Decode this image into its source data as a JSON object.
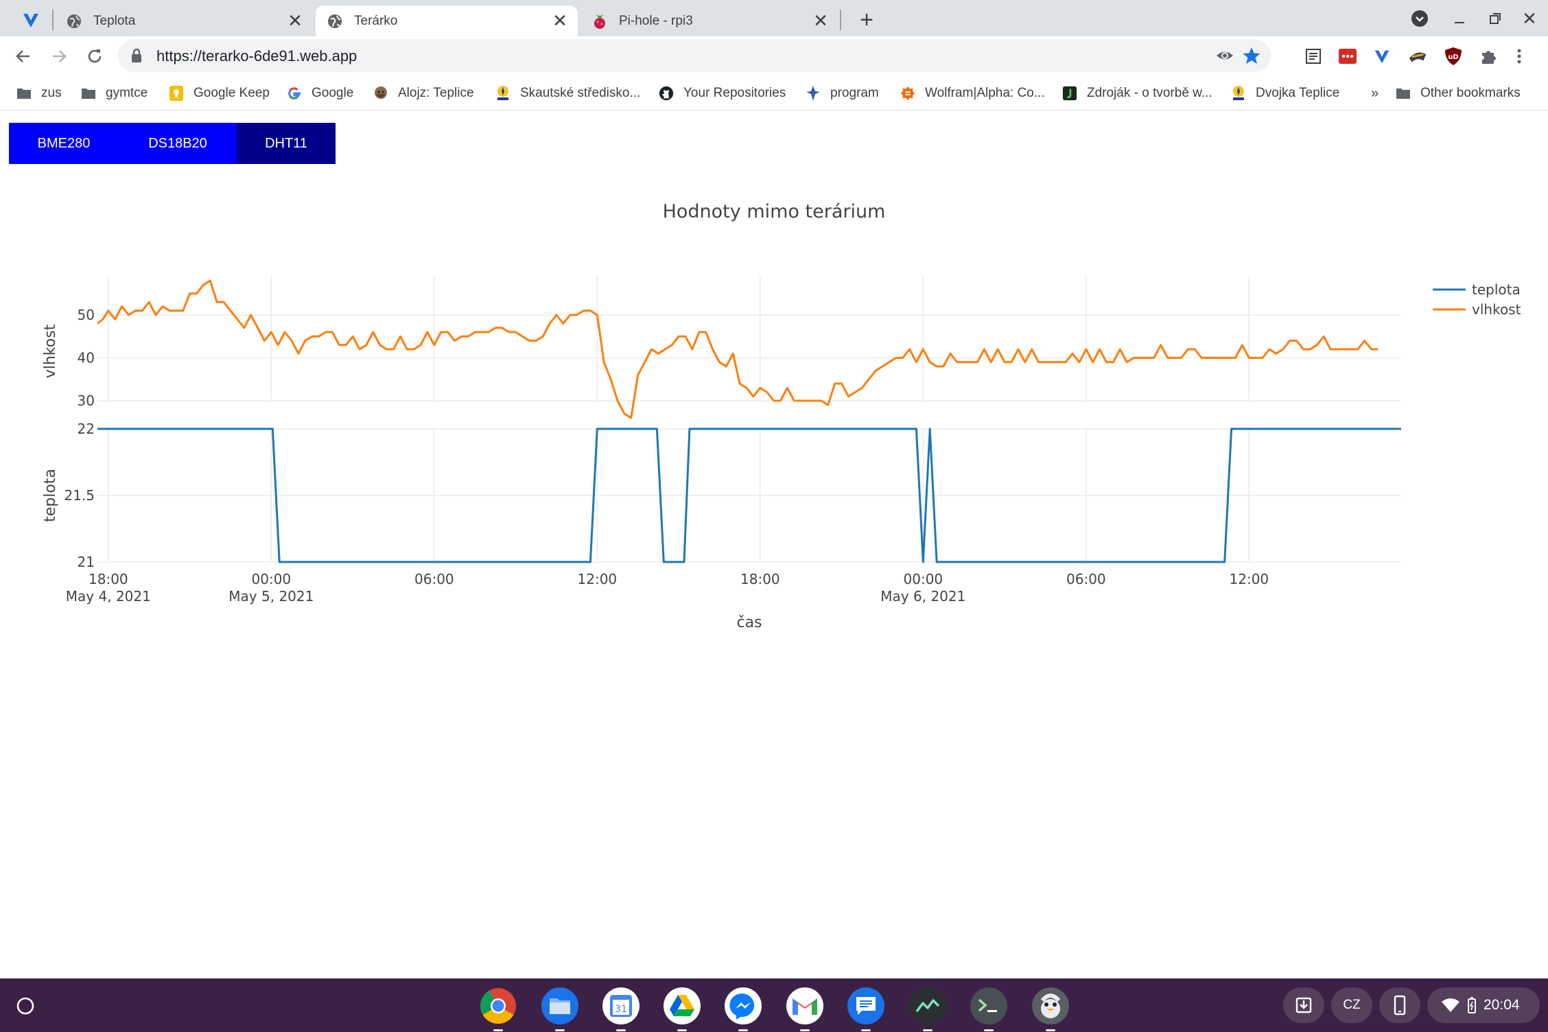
{
  "browser": {
    "tabs": [
      {
        "title": "Teplota",
        "active": false
      },
      {
        "title": "Terárko",
        "active": true
      },
      {
        "title": "Pi-hole - rpi3",
        "active": false
      }
    ],
    "url": "https://terarko-6de91.web.app",
    "bookmarks": [
      {
        "label": "zus",
        "icon": "folder-icon"
      },
      {
        "label": "gymtce",
        "icon": "folder-icon"
      },
      {
        "label": "Google Keep",
        "icon": "keep-icon"
      },
      {
        "label": "Google",
        "icon": "google-icon"
      },
      {
        "label": "Alojz: Teplice",
        "icon": "alojz-icon"
      },
      {
        "label": "Skautské středisko...",
        "icon": "scout-icon"
      },
      {
        "label": "Your Repositories",
        "icon": "github-icon"
      },
      {
        "label": "program",
        "icon": "fleur-icon"
      },
      {
        "label": "Wolfram|Alpha: Co...",
        "icon": "wolfram-icon"
      },
      {
        "label": "Zdroják - o tvorbě w...",
        "icon": "zdrojak-icon"
      },
      {
        "label": "Dvojka Teplice",
        "icon": "scout-icon"
      }
    ],
    "overflow_label": "»",
    "other_bookmarks": "Other bookmarks"
  },
  "sensor_tabs": [
    {
      "label": "BME280",
      "selected": false
    },
    {
      "label": "DS18B20",
      "selected": false
    },
    {
      "label": "DHT11",
      "selected": true
    }
  ],
  "chart_data": {
    "type": "line",
    "title": "Hodnoty mimo terárium",
    "xlabel": "čas",
    "x_ticks": [
      {
        "hour": 18,
        "label": "18:00",
        "sub": "May 4, 2021"
      },
      {
        "hour": 24,
        "label": "00:00",
        "sub": "May 5, 2021"
      },
      {
        "hour": 30,
        "label": "06:00",
        "sub": ""
      },
      {
        "hour": 36,
        "label": "12:00",
        "sub": ""
      },
      {
        "hour": 42,
        "label": "18:00",
        "sub": ""
      },
      {
        "hour": 48,
        "label": "00:00",
        "sub": "May 6, 2021"
      },
      {
        "hour": 54,
        "label": "06:00",
        "sub": ""
      },
      {
        "hour": 60,
        "label": "12:00",
        "sub": ""
      }
    ],
    "x_range_hours_since_may4": [
      17.6,
      65.6
    ],
    "legend_position": "top-right",
    "subplots": [
      {
        "ylabel": "vlhkost",
        "y_ticks": [
          30,
          40,
          50
        ],
        "series": [
          {
            "name": "vlhkost",
            "color": "#ff7f0e",
            "x": [
              17.6,
              17.8,
              18,
              18.25,
              18.5,
              18.75,
              19,
              19.25,
              19.5,
              19.75,
              20,
              20.25,
              20.5,
              20.75,
              21,
              21.25,
              21.5,
              21.75,
              22,
              22.25,
              22.5,
              22.75,
              23,
              23.25,
              23.5,
              23.75,
              24,
              24.25,
              24.5,
              24.75,
              25,
              25.25,
              25.5,
              25.75,
              26,
              26.25,
              26.5,
              26.75,
              27,
              27.25,
              27.5,
              27.75,
              28,
              28.25,
              28.5,
              28.75,
              29,
              29.25,
              29.5,
              29.75,
              30,
              30.25,
              30.5,
              30.75,
              31,
              31.25,
              31.5,
              31.75,
              32,
              32.25,
              32.5,
              32.75,
              33,
              33.25,
              33.5,
              33.75,
              34,
              34.25,
              34.5,
              34.75,
              35,
              35.25,
              35.5,
              35.75,
              36,
              36.25,
              36.5,
              36.75,
              37,
              37.25,
              37.5,
              37.75,
              38,
              38.25,
              38.5,
              38.75,
              39,
              39.25,
              39.5,
              39.75,
              40,
              40.25,
              40.5,
              40.75,
              41,
              41.25,
              41.5,
              41.75,
              42,
              42.25,
              42.5,
              42.75,
              43,
              43.25,
              43.5,
              43.75,
              44,
              44.25,
              44.5,
              44.75,
              45,
              45.25,
              45.5,
              45.75,
              46,
              46.25,
              46.5,
              46.75,
              47,
              47.25,
              47.5,
              47.75,
              48,
              48.25,
              48.5,
              48.75,
              49,
              49.25,
              49.5,
              49.75,
              50,
              50.25,
              50.5,
              50.75,
              51,
              51.25,
              51.5,
              51.75,
              52,
              52.25,
              52.5,
              52.75,
              53,
              53.25,
              53.5,
              53.75,
              54,
              54.25,
              54.5,
              54.75,
              55,
              55.25,
              55.5,
              55.75,
              56,
              56.25,
              56.5,
              56.75,
              57,
              57.25,
              57.5,
              57.75,
              58,
              58.25,
              58.5,
              58.75,
              59,
              59.25,
              59.5,
              59.75,
              60,
              60.25,
              60.5,
              60.75,
              61,
              61.25,
              61.5,
              61.75,
              62,
              62.25,
              62.5,
              62.75,
              63,
              63.25,
              63.5,
              63.75,
              64,
              64.25,
              64.5,
              64.75,
              65,
              65.25,
              65.5
            ],
            "y": [
              48,
              49,
              51,
              49,
              52,
              50,
              51,
              51,
              53,
              50,
              52,
              51,
              51,
              51,
              55,
              55,
              57,
              58,
              53,
              53,
              51,
              49,
              47,
              50,
              47,
              44,
              46,
              43,
              46,
              44,
              41,
              44,
              45,
              45,
              46,
              46,
              43,
              43,
              45,
              42,
              43,
              46,
              43,
              42,
              42,
              45,
              42,
              42,
              43,
              46,
              43,
              46,
              46,
              44,
              45,
              45,
              46,
              46,
              46,
              47,
              47,
              46,
              46,
              45,
              44,
              44,
              45,
              48,
              50,
              48,
              50,
              50,
              51,
              51,
              50,
              39,
              35,
              30,
              27,
              26,
              36,
              39,
              42,
              41,
              42,
              43,
              45,
              45,
              42,
              46,
              46,
              42,
              39,
              38,
              41,
              34,
              33,
              31,
              33,
              32,
              30,
              30,
              33,
              30,
              30,
              30,
              30,
              30,
              29,
              34,
              34,
              31,
              32,
              33,
              35,
              37,
              38,
              39,
              40,
              40,
              42,
              39,
              42,
              39,
              38,
              38,
              41,
              39,
              39,
              39,
              39,
              42,
              39,
              42,
              39,
              39,
              42,
              39,
              42,
              39,
              39,
              39,
              39,
              39,
              41,
              39,
              42,
              39,
              42,
              39,
              39,
              42,
              39,
              40,
              40,
              40,
              40,
              43,
              40,
              40,
              40,
              42,
              42,
              40,
              40,
              40,
              40,
              40,
              40,
              43,
              40,
              40,
              40,
              42,
              41,
              42,
              44,
              44,
              42,
              42,
              43,
              45,
              42,
              42,
              42,
              42,
              42,
              44,
              42,
              42
            ]
          }
        ]
      },
      {
        "ylabel": "teplota",
        "y_ticks": [
          21,
          21.5,
          22
        ],
        "series": [
          {
            "name": "teplota",
            "color": "#1f77b4",
            "x": [
              17.6,
              24.05,
              24.3,
              35.75,
              36,
              38.2,
              38.45,
              39.2,
              39.4,
              47.75,
              48,
              48.25,
              48.5,
              59.1,
              59.35,
              65.6
            ],
            "y": [
              22,
              22,
              21,
              21,
              22,
              22,
              21,
              21,
              22,
              22,
              21,
              22,
              21,
              21,
              22,
              22
            ]
          }
        ]
      }
    ]
  },
  "shelf": {
    "apps": [
      "chrome-icon",
      "files-icon",
      "calendar-icon",
      "drive-icon",
      "messenger-icon",
      "gmail-icon",
      "messages-icon",
      "activity-icon",
      "terminal-icon",
      "linux-icon"
    ],
    "calendar_day": "31",
    "keyboard_layout": "CZ",
    "time": "20:04"
  }
}
